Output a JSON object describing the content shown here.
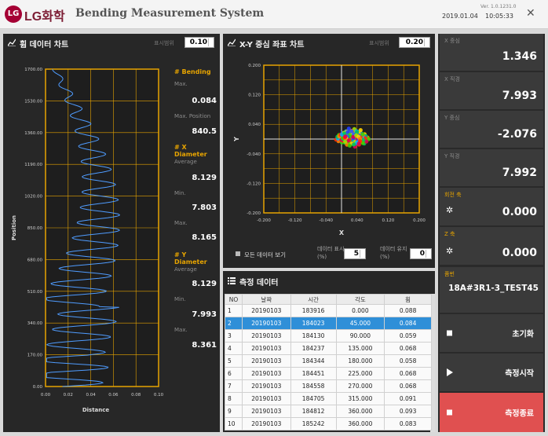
{
  "header": {
    "logo_text": "LG",
    "brand": "LG화학",
    "title": "Bending Measurement System",
    "version": "Ver. 1.0.1231.0",
    "date": "2019.01.04",
    "time": "10:05:33",
    "close_glyph": "✕"
  },
  "bending_panel": {
    "title": "휨 데이터 차트",
    "display_range_label": "표시범위",
    "display_range_value": "0.10",
    "y_axis_label": "Position",
    "x_axis_label": "Distance",
    "y_ticks": [
      "1700.00",
      "1530.00",
      "1360.00",
      "1190.00",
      "1020.00",
      "850.00",
      "680.00",
      "510.00",
      "340.00",
      "170.00",
      "0.00"
    ],
    "x_ticks": [
      "0.00",
      "0.02",
      "0.04",
      "0.06",
      "0.08",
      "0.10"
    ]
  },
  "bending_info": {
    "bending_header": "# Bending",
    "max_label": "Max.",
    "max_value": "0.084",
    "max_pos_label": "Max. Position",
    "max_pos_value": "840.5",
    "xdia_header": "# X Diameter",
    "x_avg_label": "Average",
    "x_avg_value": "8.129",
    "x_min_label": "Min.",
    "x_min_value": "7.803",
    "x_max_label": "Max.",
    "x_max_value": "8.165",
    "ydia_header": "# Y Diameter",
    "y_avg_label": "Average",
    "y_avg_value": "8.129",
    "y_min_label": "Min.",
    "y_min_value": "7.993",
    "y_max_label": "Max.",
    "y_max_value": "8.361"
  },
  "xy_panel": {
    "title": "X-Y 중심 좌표 차트",
    "display_range_label": "표시범위",
    "display_range_value": "0.20",
    "y_axis_label": "Y",
    "x_axis_label": "X",
    "y_ticks": [
      "0.200",
      "0.120",
      "0.040",
      "-0.040",
      "-0.120",
      "-0.200"
    ],
    "x_ticks": [
      "-0.200",
      "-0.120",
      "-0.040",
      "0.040",
      "0.120",
      "0.200"
    ],
    "show_all_label": "모든 데이터 보기",
    "data_display_label": "데이터 표시(%)",
    "data_display_value": "5",
    "data_keep_label": "데이터 유지(%)",
    "data_keep_value": "0"
  },
  "measure_panel": {
    "title": "측정 데이터",
    "columns": [
      "NO",
      "날짜",
      "시간",
      "각도",
      "휨"
    ],
    "rows": [
      [
        "1",
        "20190103",
        "183916",
        "0.000",
        "0.088"
      ],
      [
        "2",
        "20190103",
        "184023",
        "45.000",
        "0.084"
      ],
      [
        "3",
        "20190103",
        "184130",
        "90.000",
        "0.059"
      ],
      [
        "4",
        "20190103",
        "184237",
        "135.000",
        "0.068"
      ],
      [
        "5",
        "20190103",
        "184344",
        "180.000",
        "0.058"
      ],
      [
        "6",
        "20190103",
        "184451",
        "225.000",
        "0.068"
      ],
      [
        "7",
        "20190103",
        "184558",
        "270.000",
        "0.068"
      ],
      [
        "8",
        "20190103",
        "184705",
        "315.000",
        "0.091"
      ],
      [
        "9",
        "20190103",
        "184812",
        "360.000",
        "0.093"
      ],
      [
        "10",
        "20190103",
        "185242",
        "360.000",
        "0.083"
      ]
    ]
  },
  "right_panel": {
    "x_center_label": "X 중심",
    "x_center_value": "1.346",
    "x_dia_label": "X 직경",
    "x_dia_value": "7.993",
    "y_center_label": "Y 중심",
    "y_center_value": "-2.076",
    "y_dia_label": "Y 직경",
    "y_dia_value": "7.992",
    "rot_axis_label": "회전 축",
    "rot_axis_value": "0.000",
    "z_axis_label": "Z 축",
    "z_axis_value": "0.000",
    "model_label": "품번",
    "model_value": "18A#3R1-3_TEST45",
    "reset_label": "초기화",
    "start_label": "측정시작",
    "stop_label": "측정종료"
  },
  "colors": {
    "accent": "#e7a400",
    "selected_row": "#2f8fd8",
    "stop_button": "#e05050",
    "curve": "#4f9cff"
  }
}
